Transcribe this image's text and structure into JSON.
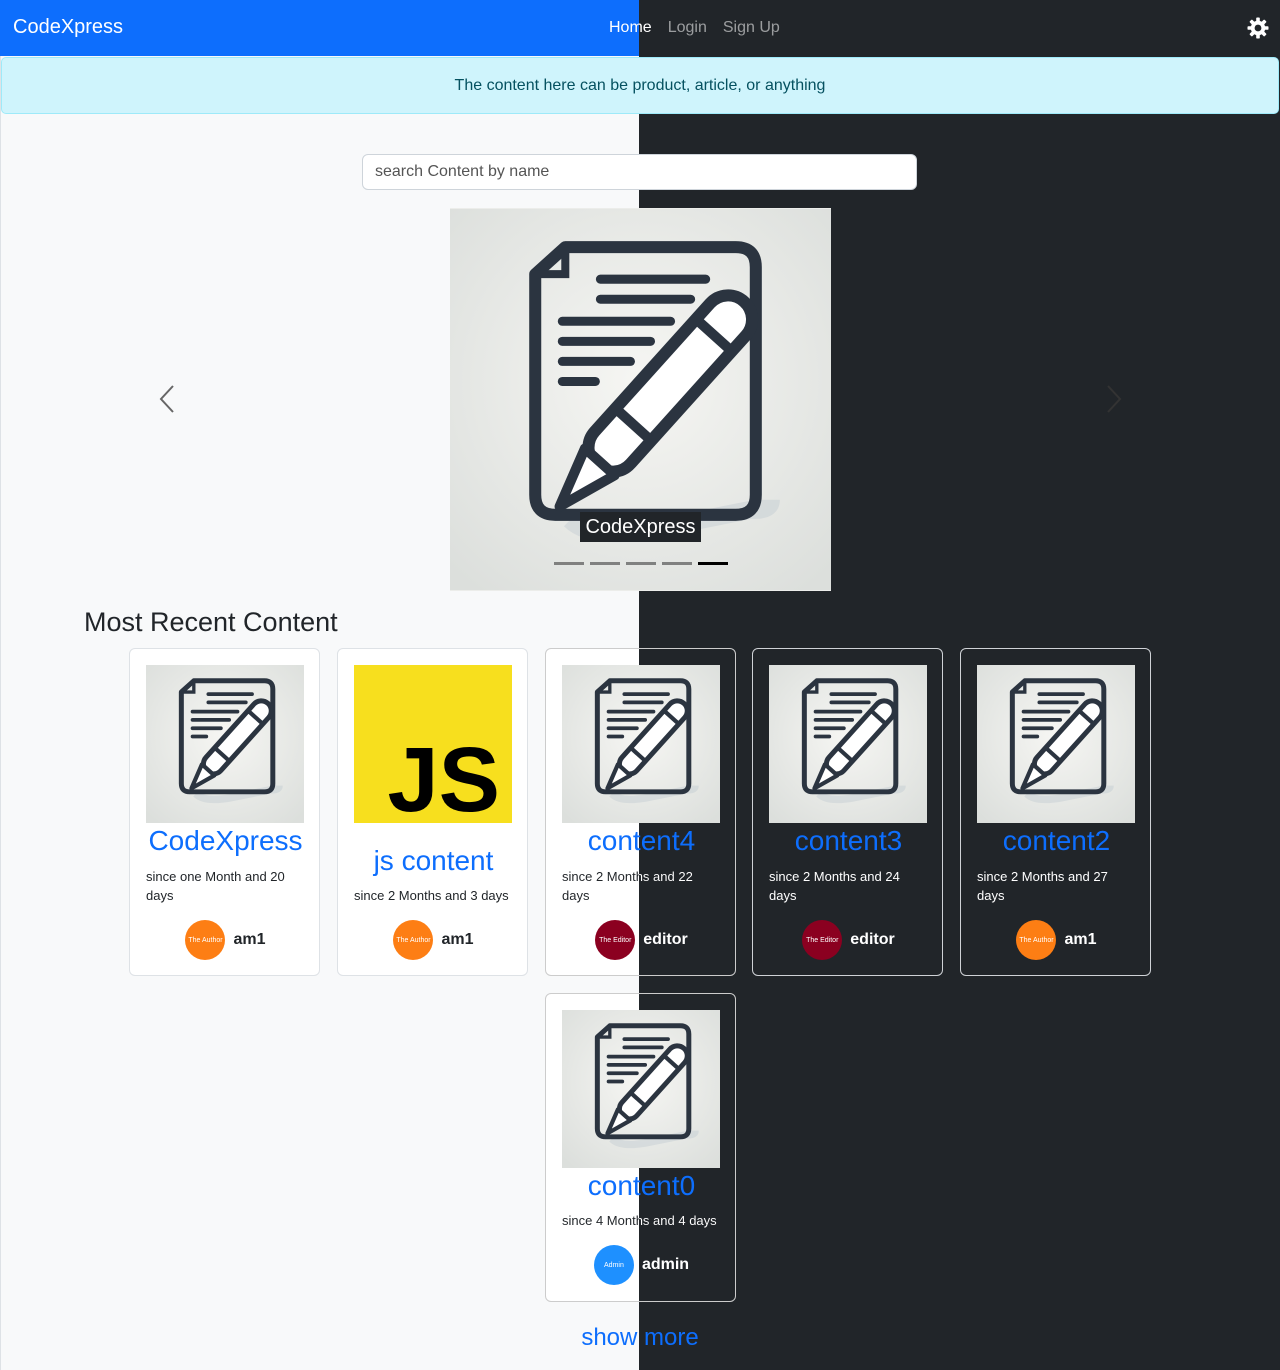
{
  "nav": {
    "brand": "CodeXpress",
    "links": [
      "Home",
      "Login",
      "Sign Up"
    ]
  },
  "alert": {
    "text": "The content here can be product, article, or anything"
  },
  "search": {
    "placeholder": "search Content by name",
    "value": ""
  },
  "carousel": {
    "caption": "CodeXpress",
    "slide_count": 5,
    "active_slide": 5
  },
  "section": {
    "title": "Most Recent Content"
  },
  "cards": [
    {
      "title": "CodeXpress",
      "date": "since one Month and 20 days",
      "author": "am1",
      "avatar_text": "The Author",
      "avatar_color": "#fd7e14",
      "image": "doc-pen-icon"
    },
    {
      "title": "js content",
      "date": "since 2 Months and 3 days",
      "author": "am1",
      "avatar_text": "The Author",
      "avatar_color": "#fd7e14",
      "image": "js-logo"
    },
    {
      "title": "content4",
      "date": "since 2 Months and 22 days",
      "author": "editor",
      "avatar_text": "The Editor",
      "avatar_color": "#8b0020",
      "image": "doc-pen-icon"
    },
    {
      "title": "content3",
      "date": "since 2 Months and 24 days",
      "author": "editor",
      "avatar_text": "The Editor",
      "avatar_color": "#8b0020",
      "image": "doc-pen-icon"
    },
    {
      "title": "content2",
      "date": "since 2 Months and 27 days",
      "author": "am1",
      "avatar_text": "The Author",
      "avatar_color": "#fd7e14",
      "image": "doc-pen-icon"
    },
    {
      "title": "content0",
      "date": "since 4 Months and 4 days",
      "author": "admin",
      "avatar_text": "Admin",
      "avatar_color": "#1e90ff",
      "image": "doc-pen-icon"
    }
  ],
  "js_logo_text": "JS",
  "show_more": "show more",
  "colors": {
    "primary": "#0d6efd",
    "dark": "#212529",
    "light": "#f8f9fa",
    "info_bg": "#cff4fc"
  }
}
